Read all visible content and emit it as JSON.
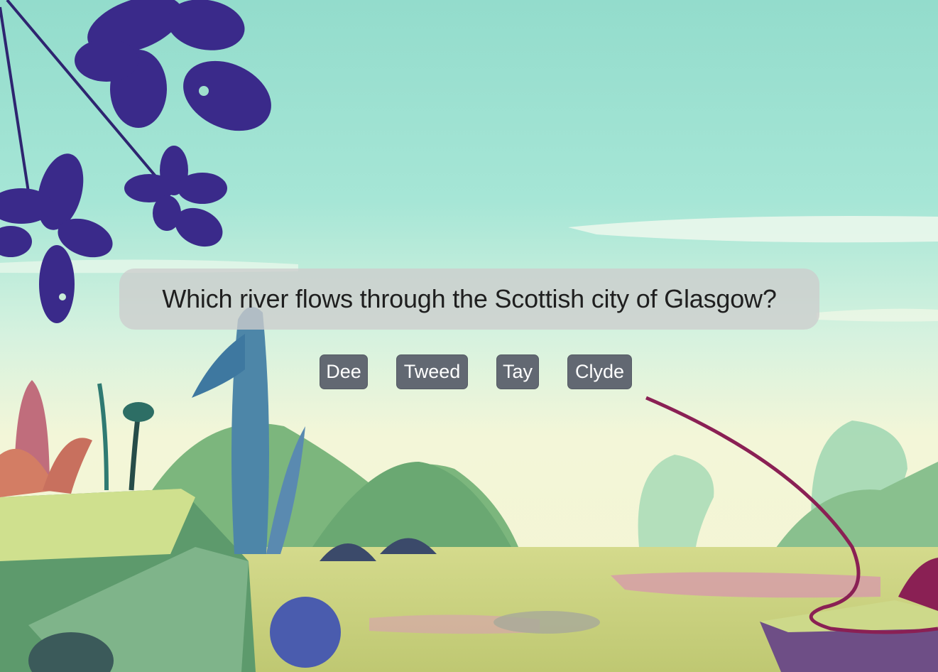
{
  "quiz": {
    "question": "Which river flows through the Scottish city of Glasgow?",
    "answers": [
      "Dee",
      "Tweed",
      "Tay",
      "Clyde"
    ]
  },
  "colors": {
    "sky_top": "#93dccc",
    "sky_bottom": "#f3f6d8",
    "ground": "#c8d27e",
    "leaf_purple": "#3a2a8a",
    "button_bg": "#626872",
    "question_bg": "#cdcdcd"
  }
}
